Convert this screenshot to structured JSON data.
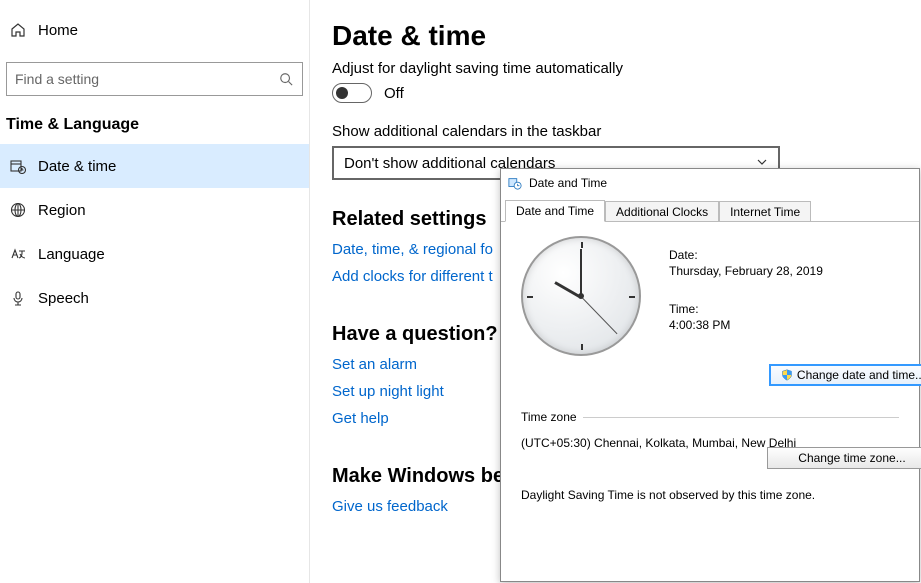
{
  "sidebar": {
    "home": "Home",
    "search_placeholder": "Find a setting",
    "section": "Time & Language",
    "items": [
      {
        "label": "Date & time"
      },
      {
        "label": "Region"
      },
      {
        "label": "Language"
      },
      {
        "label": "Speech"
      }
    ]
  },
  "main": {
    "title": "Date & time",
    "dst_label": "Adjust for daylight saving time automatically",
    "dst_state": "Off",
    "calendars_label": "Show additional calendars in the taskbar",
    "calendars_selected": "Don't show additional calendars",
    "related_heading": "Related settings",
    "related_links": [
      "Date, time, & regional fo",
      "Add clocks for different t"
    ],
    "question_heading": "Have a question?",
    "question_links": [
      "Set an alarm",
      "Set up night light",
      "Get help"
    ],
    "better_heading": "Make Windows be",
    "better_link": "Give us feedback"
  },
  "dialog": {
    "title": "Date and Time",
    "tabs": [
      "Date and Time",
      "Additional Clocks",
      "Internet Time"
    ],
    "date_label": "Date:",
    "date_value": "Thursday, February 28, 2019",
    "time_label": "Time:",
    "time_value": "4:00:38 PM",
    "change_dt": "Change date and time...",
    "tz_heading": "Time zone",
    "tz_value": "(UTC+05:30) Chennai, Kolkata, Mumbai, New Delhi",
    "change_tz": "Change time zone...",
    "dst_note": "Daylight Saving Time is not observed by this time zone."
  }
}
